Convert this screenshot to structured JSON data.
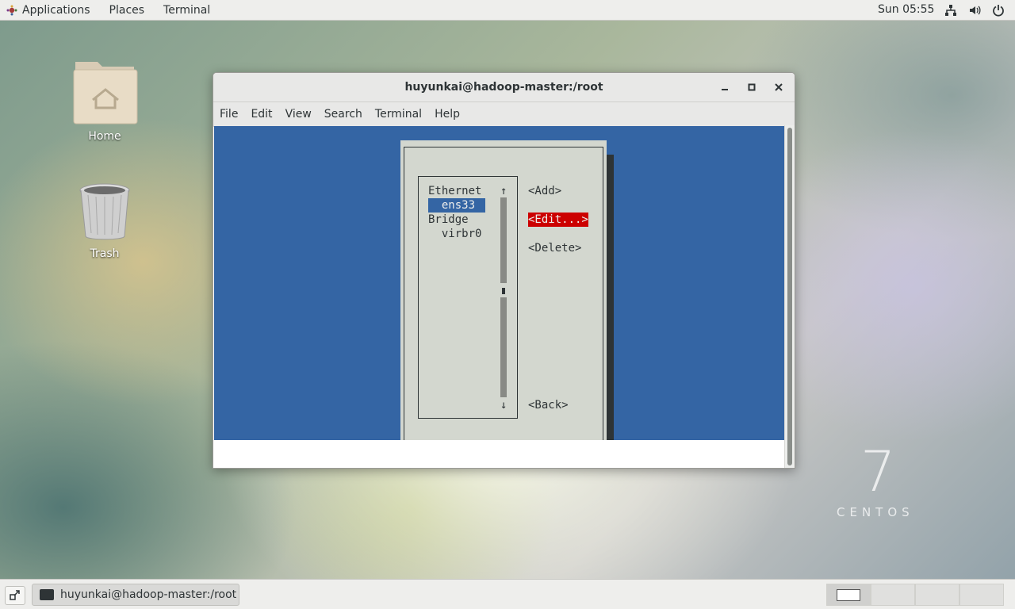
{
  "topbar": {
    "applications": "Applications",
    "places": "Places",
    "terminal": "Terminal",
    "clock": "Sun 05:55",
    "tray_icons": [
      "network-icon",
      "volume-icon",
      "power-icon"
    ]
  },
  "desktop": {
    "home_label": "Home",
    "trash_label": "Trash"
  },
  "window": {
    "title": "huyunkai@hadoop-master:/root",
    "menu": [
      "File",
      "Edit",
      "View",
      "Search",
      "Terminal",
      "Help"
    ]
  },
  "nmtui": {
    "up_arrow": "↑",
    "down_arrow": "↓",
    "items": [
      {
        "text": "Ethernet",
        "selected": false
      },
      {
        "text": "  ens33 ",
        "selected": true
      },
      {
        "text": "Bridge",
        "selected": false
      },
      {
        "text": "  virbr0",
        "selected": false
      }
    ],
    "buttons": {
      "add": "<Add>",
      "edit": "<Edit...>",
      "delete": "<Delete>",
      "back": "<Back>"
    },
    "colors": {
      "background": "#3465a4",
      "dialog": "#d3d7cf",
      "focus": "#cc0000"
    }
  },
  "watermark": {
    "number": "7",
    "word": "CENTOS"
  },
  "taskbar": {
    "task_label": "huyunkai@hadoop-master:/root",
    "workspaces": 4
  }
}
